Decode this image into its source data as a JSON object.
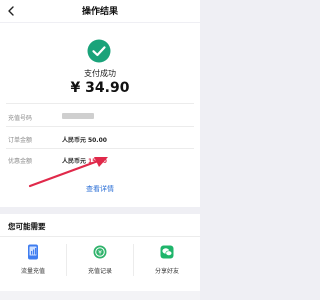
{
  "navbar": {
    "title": "操作结果",
    "back_icon": "chevron-left-icon"
  },
  "result": {
    "status_icon": "check-circle-icon",
    "status_color": "#1aa37a",
    "status_text": "支付成功",
    "amount": "¥ 34.90",
    "rows": [
      {
        "label": "充值号码",
        "value_masked": true
      },
      {
        "label": "订单金额",
        "prefix": "人民币元",
        "value": "50.00"
      },
      {
        "label": "优惠金额",
        "prefix": "人民币元",
        "value": "15.10",
        "value_color": "#e0294a"
      }
    ],
    "details_link": "查看详情"
  },
  "recommend": {
    "title": "您可能需要",
    "actions": [
      {
        "label": "流量充值",
        "icon": "phone-data-icon",
        "color": "#3f7df0"
      },
      {
        "label": "充值记录",
        "icon": "record-coin-icon",
        "color": "#2fb36b"
      },
      {
        "label": "分享好友",
        "icon": "chat-bubble-icon",
        "color": "#1fb56b"
      }
    ]
  },
  "annotation": {
    "arrow_color": "#e0294a"
  }
}
